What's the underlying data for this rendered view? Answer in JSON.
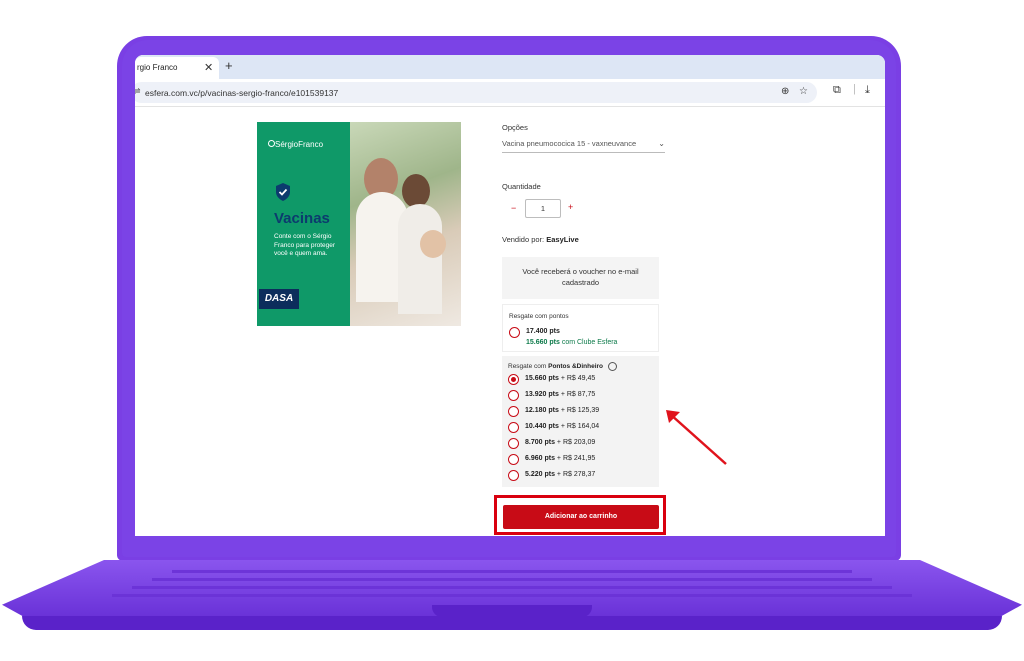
{
  "browser": {
    "tab_title": "rgio Franco",
    "tab_close": "✕",
    "new_tab": "+",
    "url": "esfera.com.vc/p/vacinas-sergio-franco/e101539137"
  },
  "banner": {
    "logo": "SérgioFranco",
    "title": "Vacinas",
    "description": "Conte com o Sérgio Franco para proteger você e quem ama.",
    "brand": "DASA"
  },
  "product": {
    "options_label": "Opções",
    "options_value": "Vacina pneumococica 15 - vaxneuvance",
    "quantity_label": "Quantidade",
    "quantity_minus": "−",
    "quantity_value": "1",
    "quantity_plus": "+",
    "sold_by_label": "Vendido por:",
    "sold_by_value": "EasyLive",
    "voucher_notice": "Você receberá o voucher no e-mail cadastrado"
  },
  "points_option": {
    "title": "Resgate com pontos",
    "points": "17.400 pts",
    "club_points": "15.660 pts",
    "club_suffix": "com Clube Esfera"
  },
  "mix_option": {
    "title_prefix": "Resgate com",
    "title_bold": "Pontos &Dinheiro",
    "items": [
      {
        "pts": "15.660 pts",
        "money": "+ R$ 49,45",
        "selected": true
      },
      {
        "pts": "13.920 pts",
        "money": "+ R$ 87,75",
        "selected": false
      },
      {
        "pts": "12.180 pts",
        "money": "+ R$ 125,39",
        "selected": false
      },
      {
        "pts": "10.440 pts",
        "money": "+ R$ 164,04",
        "selected": false
      },
      {
        "pts": "8.700 pts",
        "money": "+ R$ 203,09",
        "selected": false
      },
      {
        "pts": "6.960 pts",
        "money": "+ R$ 241,95",
        "selected": false
      },
      {
        "pts": "5.220 pts",
        "money": "+ R$ 278,37",
        "selected": false
      }
    ]
  },
  "cart_button": "Adicionar ao carrinho",
  "colors": {
    "accent": "#c80b16",
    "laptop": "#7a3fe4",
    "banner_green": "#0f9968"
  }
}
